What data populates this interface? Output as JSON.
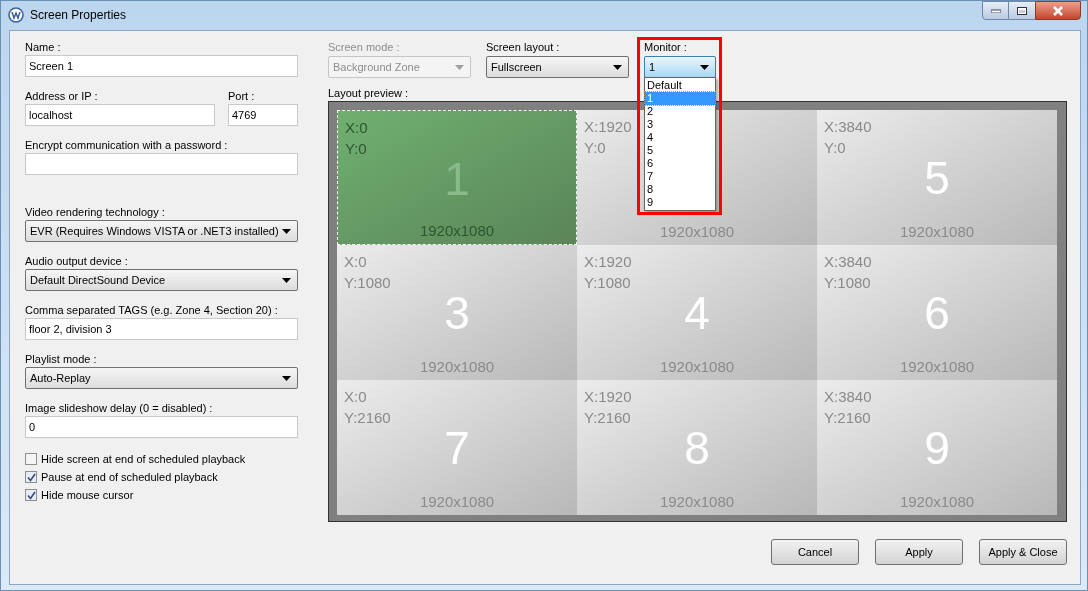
{
  "window": {
    "title": "Screen Properties"
  },
  "fields": [
    {
      "kind": "text",
      "label": "Name :",
      "value": "Screen 1"
    },
    {
      "kind": "pair",
      "label": "Address or IP :",
      "value": "localhost",
      "label2": "Port :",
      "value2": "4769"
    },
    {
      "kind": "text",
      "label": "Encrypt communication with a password :"
    },
    {
      "kind": "select",
      "label": "Video rendering technology :",
      "value": "EVR (Requires Windows VISTA or .NET3 installed)"
    },
    {
      "kind": "select",
      "label": "Audio output device :",
      "value": "Default DirectSound Device"
    },
    {
      "kind": "text",
      "label": "Comma separated TAGS (e.g. Zone 4, Section 20) :",
      "value": "floor 2, division 3"
    },
    {
      "kind": "select",
      "label": "Playlist mode :",
      "value": "Auto-Replay"
    },
    {
      "kind": "text",
      "label": "Image slideshow delay (0 = disabled) :",
      "value": "0"
    }
  ],
  "checkboxes": [
    {
      "label": "Hide screen at end of scheduled playback",
      "checked": false
    },
    {
      "label": "Pause at end of scheduled playback",
      "checked": true
    },
    {
      "label": "Hide mouse cursor",
      "checked": true
    }
  ],
  "screen_mode": {
    "label": "Screen mode :",
    "value": "Background Zone",
    "disabled": true
  },
  "screen_layout": {
    "label": "Screen layout :",
    "value": "Fullscreen"
  },
  "monitor": {
    "label": "Monitor :",
    "value": "1",
    "options": [
      {
        "label": "Default",
        "selected": false
      },
      {
        "label": "1",
        "selected": true
      },
      {
        "label": "2",
        "selected": false
      },
      {
        "label": "3",
        "selected": false
      },
      {
        "label": "4",
        "selected": false
      },
      {
        "label": "5",
        "selected": false
      },
      {
        "label": "6",
        "selected": false
      },
      {
        "label": "7",
        "selected": false
      },
      {
        "label": "8",
        "selected": false
      },
      {
        "label": "9",
        "selected": false
      }
    ]
  },
  "preview": {
    "label": "Layout preview :",
    "tiles": [
      {
        "x": "X:0",
        "y": "Y:0",
        "number": "1",
        "size": "1920x1080",
        "selected": true
      },
      {
        "x": "X:1920",
        "y": "Y:0",
        "size": "1920x1080",
        "selected": false
      },
      {
        "x": "X:3840",
        "y": "Y:0",
        "number": "5",
        "size": "1920x1080",
        "selected": false
      },
      {
        "x": "X:0",
        "y": "Y:1080",
        "number": "3",
        "size": "1920x1080",
        "selected": false
      },
      {
        "x": "X:1920",
        "y": "Y:1080",
        "number": "4",
        "size": "1920x1080",
        "selected": false
      },
      {
        "x": "X:3840",
        "y": "Y:1080",
        "number": "6",
        "size": "1920x1080",
        "selected": false
      },
      {
        "x": "X:0",
        "y": "Y:2160",
        "number": "7",
        "size": "1920x1080",
        "selected": false
      },
      {
        "x": "X:1920",
        "y": "Y:2160",
        "number": "8",
        "size": "1920x1080",
        "selected": false
      },
      {
        "x": "X:3840",
        "y": "Y:2160",
        "number": "9",
        "size": "1920x1080",
        "selected": false
      }
    ]
  },
  "buttons": [
    "Cancel",
    "Apply",
    "Apply & Close"
  ]
}
